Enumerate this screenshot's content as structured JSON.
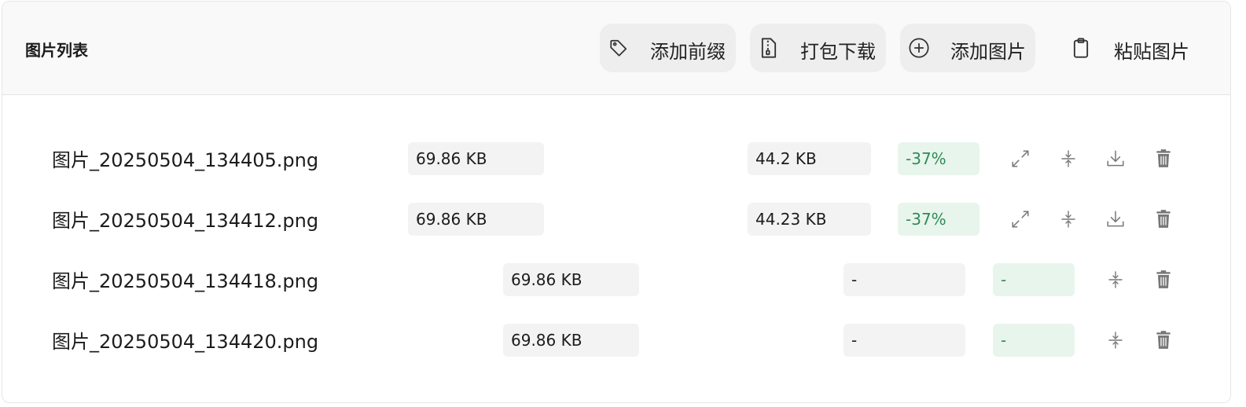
{
  "header": {
    "title": "图片列表",
    "buttons": {
      "add_prefix": "添加前缀",
      "pack_download": "打包下载",
      "add_image": "添加图片",
      "paste_image": "粘贴图片"
    }
  },
  "files": [
    {
      "name": "图片_20250504_134405.png",
      "original_size": "69.86 KB",
      "compressed_size": "44.2 KB",
      "ratio": "-37%"
    },
    {
      "name": "图片_20250504_134412.png",
      "original_size": "69.86 KB",
      "compressed_size": "44.23 KB",
      "ratio": "-37%"
    },
    {
      "name": "图片_20250504_134418.png",
      "original_size": "69.86 KB",
      "compressed_size": "-",
      "ratio": "-"
    },
    {
      "name": "图片_20250504_134420.png",
      "original_size": "69.86 KB",
      "compressed_size": "-",
      "ratio": "-"
    }
  ],
  "icons": {
    "add_prefix": "tag-icon",
    "pack_download": "zip-file-icon",
    "add_image": "plus-circle-icon",
    "paste_image": "clipboard-icon",
    "preview": "expand-icon",
    "compress": "compress-icon",
    "download": "download-icon",
    "delete": "trash-icon"
  },
  "colors": {
    "ratio_text": "#2e8b57",
    "ratio_bg": "#e8f5ec",
    "icon": "#777777"
  }
}
